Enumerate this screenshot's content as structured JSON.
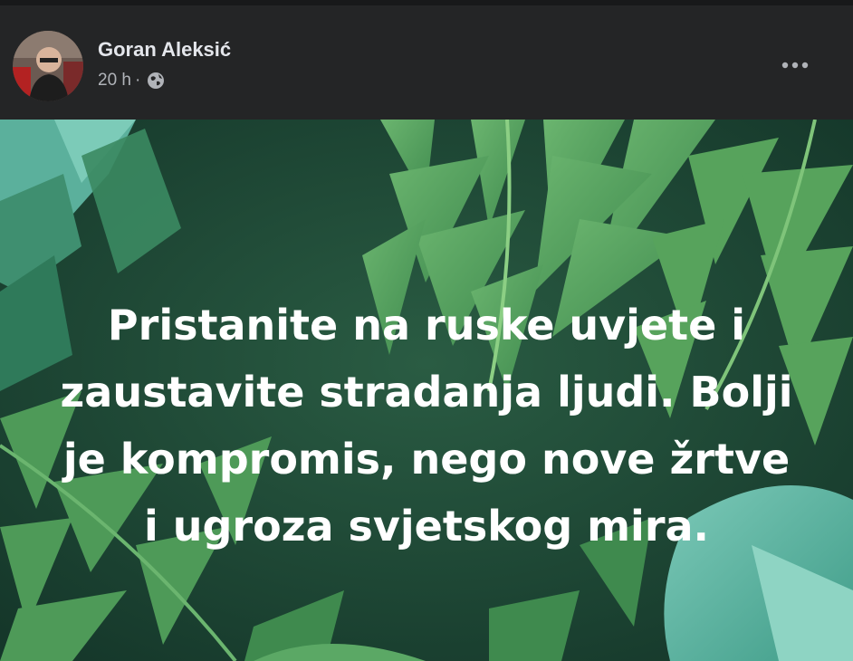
{
  "post": {
    "author": "Goran Aleksić",
    "time": "20 h",
    "separator": "·",
    "privacy_icon": "globe-icon",
    "more_icon": "more-options-icon",
    "text_lines": [
      "Pristanite na ruske uvjete i",
      "zaustavite stradanja ljudi. Bolji",
      "je kompromis, nego nove žrtve",
      "i ugroza svjetskog mira."
    ]
  },
  "colors": {
    "background": "#242526",
    "name": "#e4e6eb",
    "meta": "#b0b3b8",
    "image_base": "#1f4a36",
    "leaf": "#4f9a5a",
    "teal_leaf": "#5fb3a2"
  }
}
